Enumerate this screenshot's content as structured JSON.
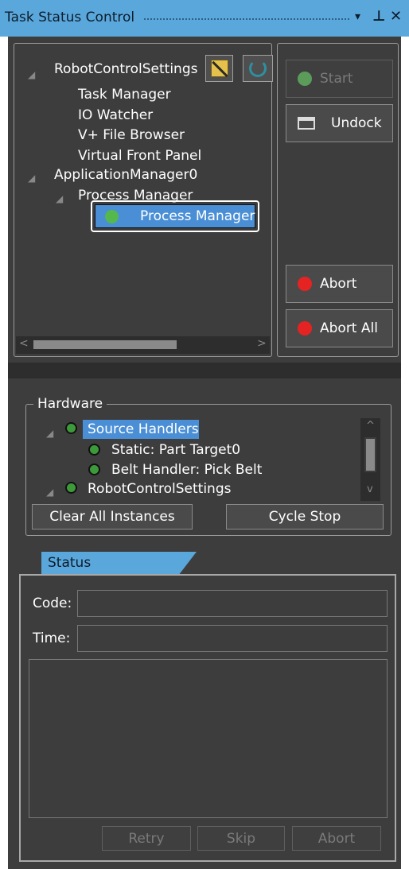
{
  "window": {
    "title": "Task Status Control",
    "controls": {
      "dropdown": "▾",
      "pin": "⊥",
      "close": "✕"
    }
  },
  "task_tree": {
    "items": [
      {
        "label": "RobotControlSettings",
        "level": 0,
        "expanded": true
      },
      {
        "label": "Task Manager",
        "level": 1
      },
      {
        "label": "IO Watcher",
        "level": 1
      },
      {
        "label": "V+ File Browser",
        "level": 1
      },
      {
        "label": "Virtual Front Panel",
        "level": 1
      },
      {
        "label": "ApplicationManager0",
        "level": 0,
        "expanded": true
      },
      {
        "label": "Process Manager",
        "level": 1,
        "expanded": true
      },
      {
        "label": "Process Manager",
        "level": 2,
        "selected": true,
        "status": "green"
      }
    ],
    "scroll_left": "<",
    "scroll_right": ">"
  },
  "task_buttons": {
    "start": "Start",
    "undock": "Undock",
    "abort": "Abort",
    "abort_all": "Abort All"
  },
  "hardware": {
    "group_label": "Hardware",
    "items": [
      {
        "label": "Source Handlers",
        "selected": true
      },
      {
        "label": "Static: Part Target0"
      },
      {
        "label": "Belt Handler: Pick Belt"
      },
      {
        "label": "RobotControlSettings"
      }
    ],
    "scroll_up": "^",
    "scroll_down": "v",
    "clear_all": "Clear All Instances",
    "cycle_stop": "Cycle Stop"
  },
  "status": {
    "tab": "Status",
    "code_label": "Code:",
    "code_value": "",
    "time_label": "Time:",
    "time_value": "",
    "retry": "Retry",
    "skip": "Skip",
    "abort": "Abort"
  },
  "colors": {
    "accent": "#5aa7dc",
    "panel_bg": "#3d3d3d",
    "selection": "#4a8fd6",
    "status_green": "#4fb04f",
    "status_red": "#e52323"
  }
}
